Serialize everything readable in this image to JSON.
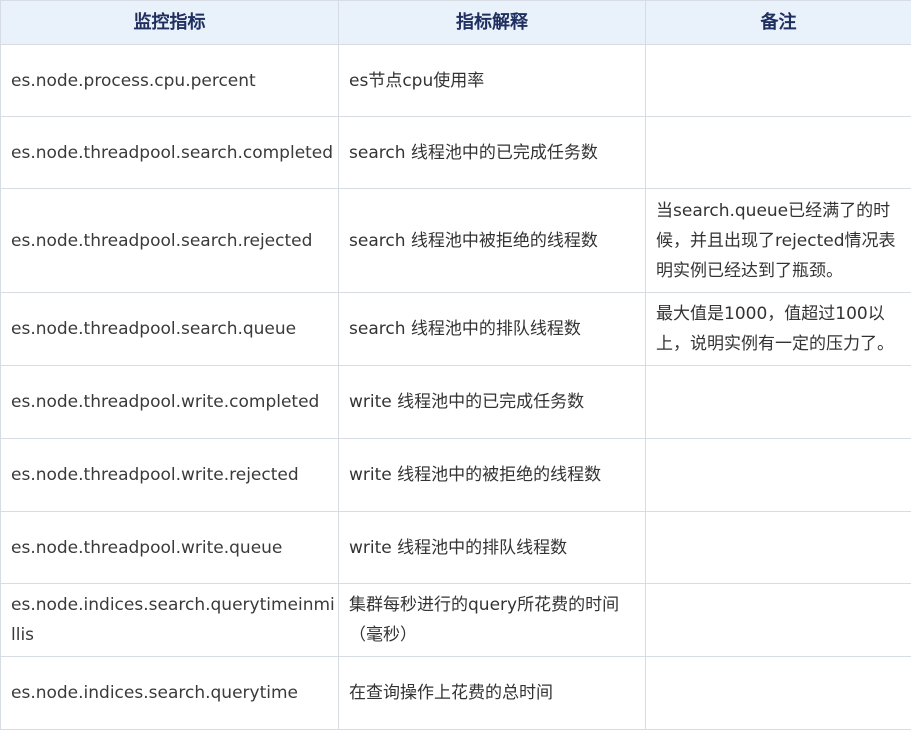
{
  "header": {
    "metric": "监控指标",
    "explanation": "指标解释",
    "note": "备注"
  },
  "rows": [
    {
      "metric": "es.node.process.cpu.percent",
      "explanation": "es节点cpu使用率",
      "note": ""
    },
    {
      "metric": "es.node.threadpool.search.completed",
      "explanation": " search 线程池中的已完成任务数",
      "note": ""
    },
    {
      "metric": "es.node.threadpool.search.rejected",
      "explanation": "search 线程池中被拒绝的线程数",
      "note": "当search.queue已经满了的时候，并且出现了rejected情况表明实例已经达到了瓶颈。"
    },
    {
      "metric": "es.node.threadpool.search.queue",
      "explanation": "search 线程池中的排队线程数",
      "note": "最大值是1000，值超过100以上，说明实例有一定的压力了。"
    },
    {
      "metric": "es.node.threadpool.write.completed",
      "explanation": "write 线程池中的已完成任务数",
      "note": ""
    },
    {
      "metric": "es.node.threadpool.write.rejected",
      "explanation": "write 线程池中的被拒绝的线程数",
      "note": ""
    },
    {
      "metric": "es.node.threadpool.write.queue",
      "explanation": "write 线程池中的排队线程数",
      "note": ""
    },
    {
      "metric": "es.node.indices.search.querytimeinmillis",
      "explanation": "集群每秒进行的query所花费的时间（毫秒）",
      "note": ""
    },
    {
      "metric": "es.node.indices.search.querytime",
      "explanation": " 在查询操作上花费的总时间",
      "note": ""
    }
  ]
}
